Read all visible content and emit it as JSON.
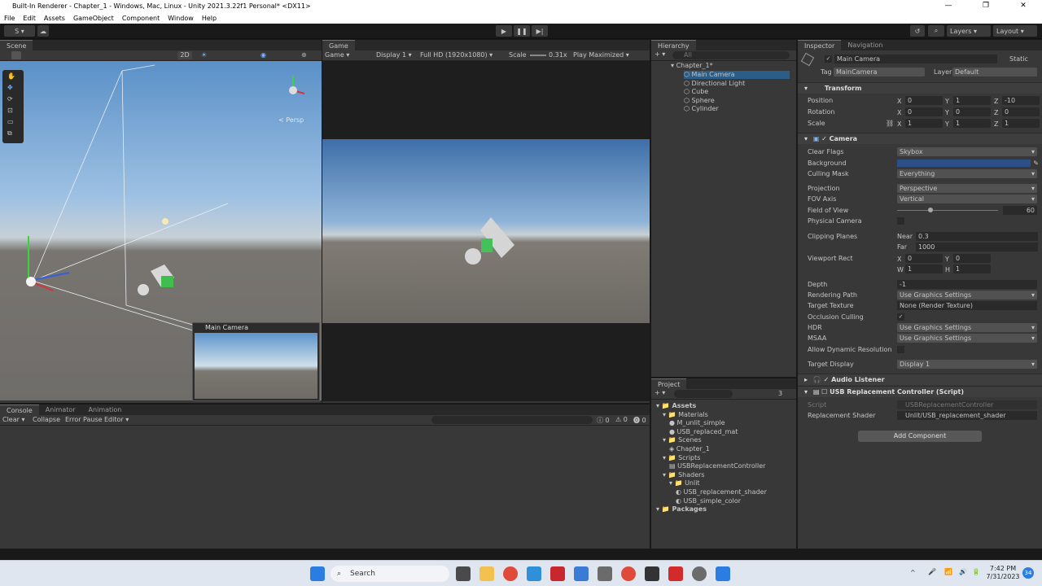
{
  "window": {
    "title": "Built-In Renderer - Chapter_1 - Windows, Mac, Linux - Unity 2021.3.22f1 Personal* <DX11>",
    "controls": [
      "—",
      "❐",
      "✕"
    ]
  },
  "menu": [
    "File",
    "Edit",
    "Assets",
    "GameObject",
    "Component",
    "Window",
    "Help"
  ],
  "toolbar": {
    "account": "S ▾",
    "layers": "Layers",
    "layout": "Layout"
  },
  "scene": {
    "tab": "Scene",
    "mode_2d": "2D",
    "persp": "< Persp",
    "camera_preview_title": "Main Camera"
  },
  "game": {
    "tab": "Game",
    "mode": "Game",
    "display": "Display 1",
    "resolution": "Full HD (1920x1080)",
    "scale_label": "Scale",
    "scale_value": "0.31x",
    "play_mode": "Play Maximized"
  },
  "hierarchy": {
    "tab": "Hierarchy",
    "search_placeholder": "All",
    "scene": "Chapter_1*",
    "items": [
      "Main Camera",
      "Directional Light",
      "Cube",
      "Sphere",
      "Cylinder"
    ]
  },
  "project": {
    "tab": "Project",
    "count": "3",
    "rows": [
      {
        "label": "Assets",
        "depth": 0,
        "kind": "folder",
        "bold": true
      },
      {
        "label": "Materials",
        "depth": 1,
        "kind": "folder"
      },
      {
        "label": "M_unlit_simple",
        "depth": 2,
        "kind": "material"
      },
      {
        "label": "USB_replaced_mat",
        "depth": 2,
        "kind": "material"
      },
      {
        "label": "Scenes",
        "depth": 1,
        "kind": "folder"
      },
      {
        "label": "Chapter_1",
        "depth": 2,
        "kind": "scene"
      },
      {
        "label": "Scripts",
        "depth": 1,
        "kind": "folder"
      },
      {
        "label": "USBReplacementController",
        "depth": 2,
        "kind": "script"
      },
      {
        "label": "Shaders",
        "depth": 1,
        "kind": "folder"
      },
      {
        "label": "Unlit",
        "depth": 2,
        "kind": "folder"
      },
      {
        "label": "USB_replacement_shader",
        "depth": 3,
        "kind": "shader"
      },
      {
        "label": "USB_simple_color",
        "depth": 3,
        "kind": "shader"
      },
      {
        "label": "Packages",
        "depth": 0,
        "kind": "folder",
        "bold": true
      }
    ]
  },
  "console": {
    "tabs": [
      "Console",
      "Animator",
      "Animation"
    ],
    "clear": "Clear",
    "collapse": "Collapse",
    "error_pause": "Error Pause",
    "editor": "Editor",
    "counts": [
      "0",
      "0",
      "0"
    ]
  },
  "inspector": {
    "tabs": [
      "Inspector",
      "Navigation"
    ],
    "object_name": "Main Camera",
    "static_label": "Static",
    "tag_label": "Tag",
    "tag": "MainCamera",
    "layer_label": "Layer",
    "layer": "Default",
    "transform": {
      "title": "Transform",
      "position": {
        "label": "Position",
        "x": "0",
        "y": "1",
        "z": "-10"
      },
      "rotation": {
        "label": "Rotation",
        "x": "0",
        "y": "0",
        "z": "0"
      },
      "scale": {
        "label": "Scale",
        "x": "1",
        "y": "1",
        "z": "1"
      }
    },
    "camera": {
      "title": "Camera",
      "clear_flags": {
        "label": "Clear Flags",
        "value": "Skybox"
      },
      "background": {
        "label": "Background",
        "color": "#2b4f86"
      },
      "culling_mask": {
        "label": "Culling Mask",
        "value": "Everything"
      },
      "projection": {
        "label": "Projection",
        "value": "Perspective"
      },
      "fov_axis": {
        "label": "FOV Axis",
        "value": "Vertical"
      },
      "field_of_view": {
        "label": "Field of View",
        "value": "60",
        "slider_fraction": 0.33
      },
      "physical_camera": {
        "label": "Physical Camera"
      },
      "clipping": {
        "label": "Clipping Planes",
        "near_label": "Near",
        "near": "0.3",
        "far_label": "Far",
        "far": "1000"
      },
      "viewport": {
        "label": "Viewport Rect",
        "x": "0",
        "y": "0",
        "w": "1",
        "h": "1"
      },
      "depth": {
        "label": "Depth",
        "value": "-1"
      },
      "rendering_path": {
        "label": "Rendering Path",
        "value": "Use Graphics Settings"
      },
      "target_texture": {
        "label": "Target Texture",
        "value": "None (Render Texture)"
      },
      "occlusion": {
        "label": "Occlusion Culling"
      },
      "hdr": {
        "label": "HDR",
        "value": "Use Graphics Settings"
      },
      "msaa": {
        "label": "MSAA",
        "value": "Use Graphics Settings"
      },
      "dynamic_res": {
        "label": "Allow Dynamic Resolution"
      },
      "target_display": {
        "label": "Target Display",
        "value": "Display 1"
      }
    },
    "audio_listener": {
      "title": "Audio Listener"
    },
    "usb": {
      "title": "USB Replacement Controller (Script)",
      "script_label": "Script",
      "script": "USBReplacementController",
      "shader_label": "Replacement Shader",
      "shader": "Unlit/USB_replacement_shader"
    },
    "add_component": "Add Component"
  },
  "taskbar": {
    "search": "Search",
    "time": "7:42 PM",
    "date": "7/31/2023",
    "badge": "34"
  }
}
